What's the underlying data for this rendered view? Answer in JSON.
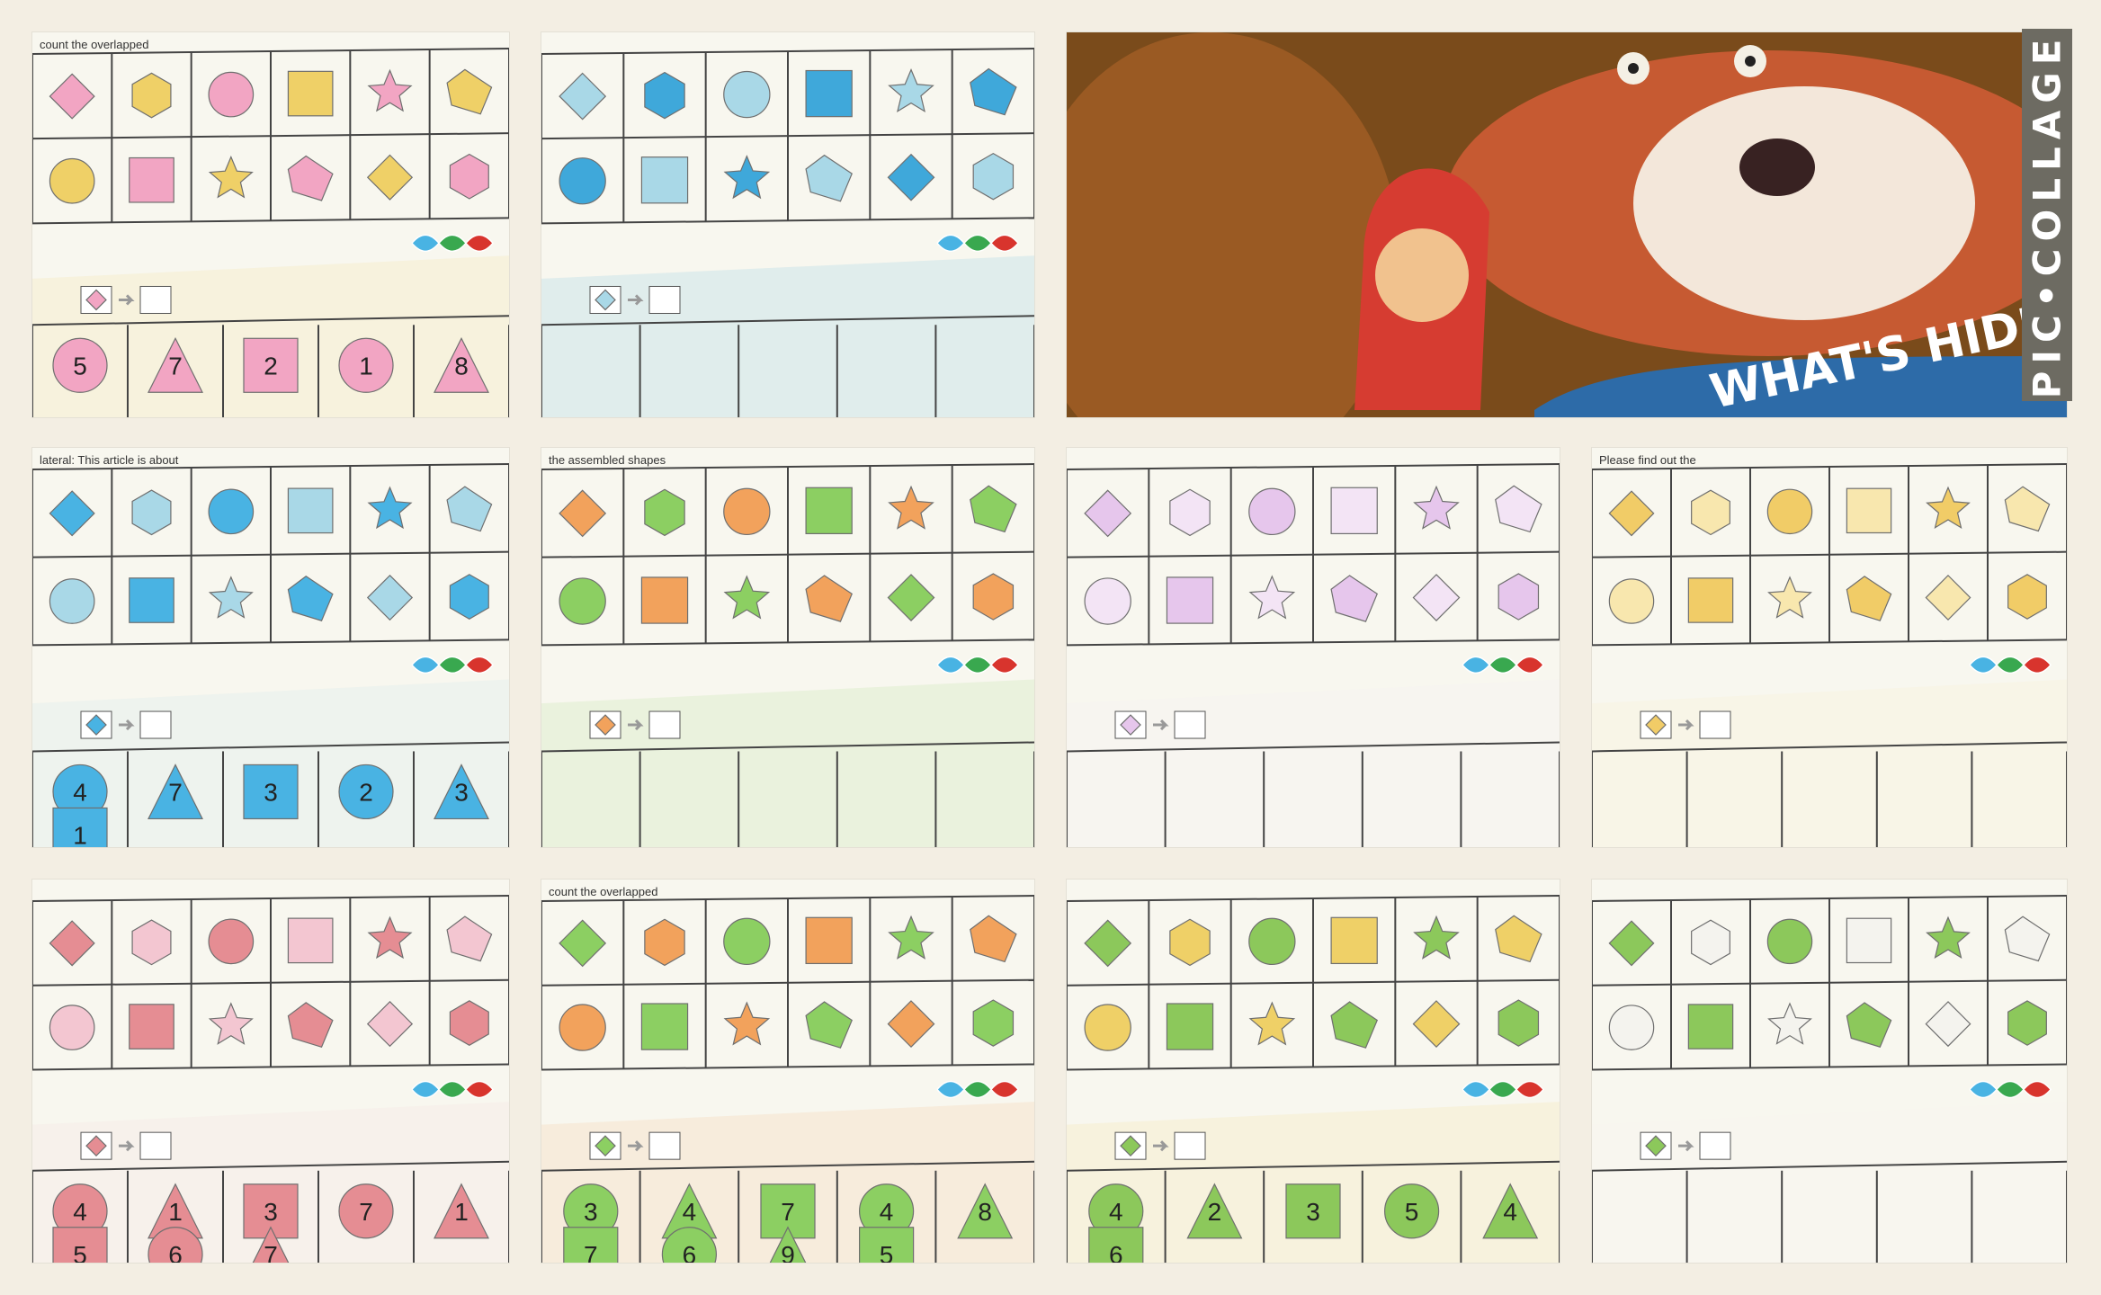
{
  "collage": {
    "watermark": "PIC•COLLAGE",
    "book_title": "WHAT'S HIDING THERE"
  },
  "tiles": [
    {
      "name": "pink-yellow-worksheet",
      "colors": {
        "primary": "#f2a5c3",
        "secondary": "#efd067"
      },
      "header": "count the overlapped",
      "numbers": [
        "5",
        "7",
        "2",
        "1",
        "8"
      ]
    },
    {
      "name": "blue-fragment-worksheet",
      "colors": {
        "primary": "#a9d8e7",
        "secondary": "#3fa8da"
      },
      "header": "",
      "numbers": []
    },
    {
      "name": "storybook-cover",
      "colors": {
        "primary": "#c65a32",
        "secondary": "#6a4b1f"
      },
      "header": "",
      "numbers": []
    },
    {
      "name": "blue-shapes-worksheet",
      "colors": {
        "primary": "#49b3e3",
        "secondary": "#a9d8e7"
      },
      "header": "lateral: This article is about",
      "numbers": [
        "4",
        "7",
        "3",
        "2",
        "3",
        "1"
      ]
    },
    {
      "name": "orange-green-worksheet",
      "colors": {
        "primary": "#f2a25c",
        "secondary": "#8ccf62"
      },
      "header": "the assembled shapes",
      "numbers": []
    },
    {
      "name": "lilac-worksheet",
      "colors": {
        "primary": "#e6c6ec",
        "secondary": "#f3e4f5"
      },
      "header": "",
      "numbers": []
    },
    {
      "name": "mustard-worksheet",
      "colors": {
        "primary": "#f1cc67",
        "secondary": "#f8e7ae"
      },
      "header": "Please find out the",
      "numbers": []
    },
    {
      "name": "rose-worksheet",
      "colors": {
        "primary": "#e58d93",
        "secondary": "#f3c6d1"
      },
      "header": "",
      "numbers": [
        "4",
        "1",
        "3",
        "7",
        "1",
        "5",
        "6",
        "7"
      ]
    },
    {
      "name": "green-orange-worksheet",
      "colors": {
        "primary": "#8ccf62",
        "secondary": "#f2a25c"
      },
      "header": "count the overlapped",
      "numbers": [
        "3",
        "4",
        "7",
        "4",
        "8",
        "7",
        "6",
        "9",
        "5"
      ]
    },
    {
      "name": "olive-yellow-worksheet",
      "colors": {
        "primary": "#8cc85b",
        "secondary": "#efd067"
      },
      "header": "",
      "numbers": [
        "4",
        "2",
        "3",
        "5",
        "4",
        "6"
      ]
    },
    {
      "name": "green-shadows-worksheet",
      "colors": {
        "primary": "#8cc85b",
        "secondary": "#f4f3ee"
      },
      "header": "",
      "numbers": []
    }
  ]
}
